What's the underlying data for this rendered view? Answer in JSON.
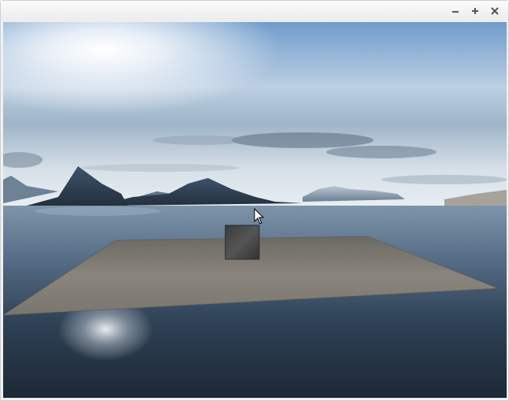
{
  "window": {
    "title": "",
    "controls": [
      {
        "name": "minimize",
        "icon": "minimize-icon"
      },
      {
        "name": "maximize",
        "icon": "plus-icon"
      },
      {
        "name": "close",
        "icon": "close-icon"
      }
    ]
  },
  "scene": {
    "description_icons": [
      "sun",
      "mountains",
      "water",
      "floor-plane",
      "textured-cube"
    ],
    "colors": {
      "sky_top": "#4f7fb0",
      "sky_mid": "#c9d8e6",
      "water": "#27384a",
      "floor": "#7e7a72",
      "cube": "#4a4a4a"
    }
  },
  "cursor": {
    "icon": "arrow-cursor-icon"
  }
}
